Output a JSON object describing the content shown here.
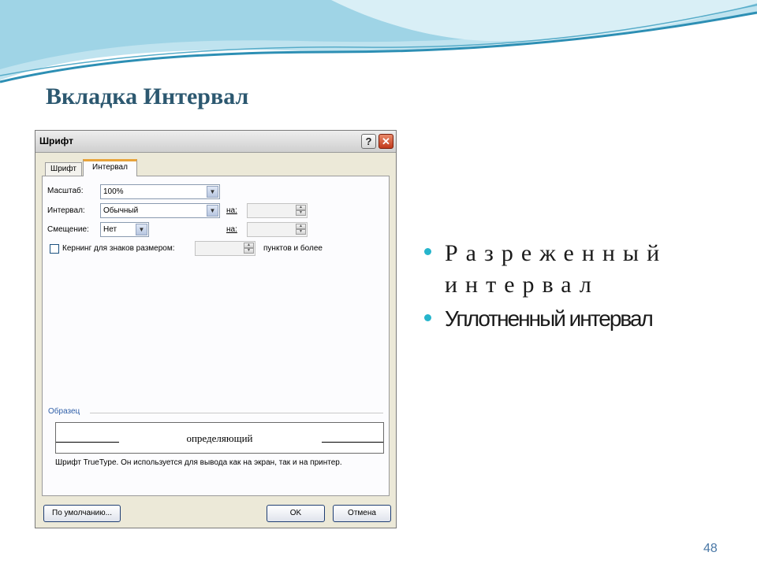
{
  "slide": {
    "title": "Вкладка Интервал",
    "page_number": "48",
    "bullets": [
      "Разреженный интервал",
      "Уплотненный интервал"
    ]
  },
  "dialog": {
    "title": "Шрифт",
    "help_icon": "question-mark-icon",
    "close_icon": "close-x-icon",
    "tabs": [
      {
        "label": "Шрифт",
        "active": false
      },
      {
        "label": "Интервал",
        "active": true
      }
    ],
    "fields": {
      "scale_label": "Масштаб:",
      "scale_value": "100%",
      "spacing_label": "Интервал:",
      "spacing_value": "Обычный",
      "spacing_by_label": "на:",
      "spacing_by_value": "",
      "position_label": "Смещение:",
      "position_value": "Нет",
      "position_by_label": "на:",
      "position_by_value": "",
      "kerning_label": "Кернинг для знаков размером:",
      "kerning_checked": false,
      "kerning_value": "",
      "kerning_suffix": "пунктов и более"
    },
    "preview": {
      "group_label": "Образец",
      "sample_text": "определяющий",
      "note": "Шрифт TrueType. Он используется для вывода как на экран, так и на принтер."
    },
    "buttons": {
      "default": "По умолчанию...",
      "ok": "OK",
      "cancel": "Отмена"
    }
  },
  "colors": {
    "title": "#2c5870",
    "bullet_dot": "#26b5cc",
    "wave_dark": "#2d8fb4",
    "wave_light": "#bfe3ef",
    "page_number": "#4a78a6"
  }
}
